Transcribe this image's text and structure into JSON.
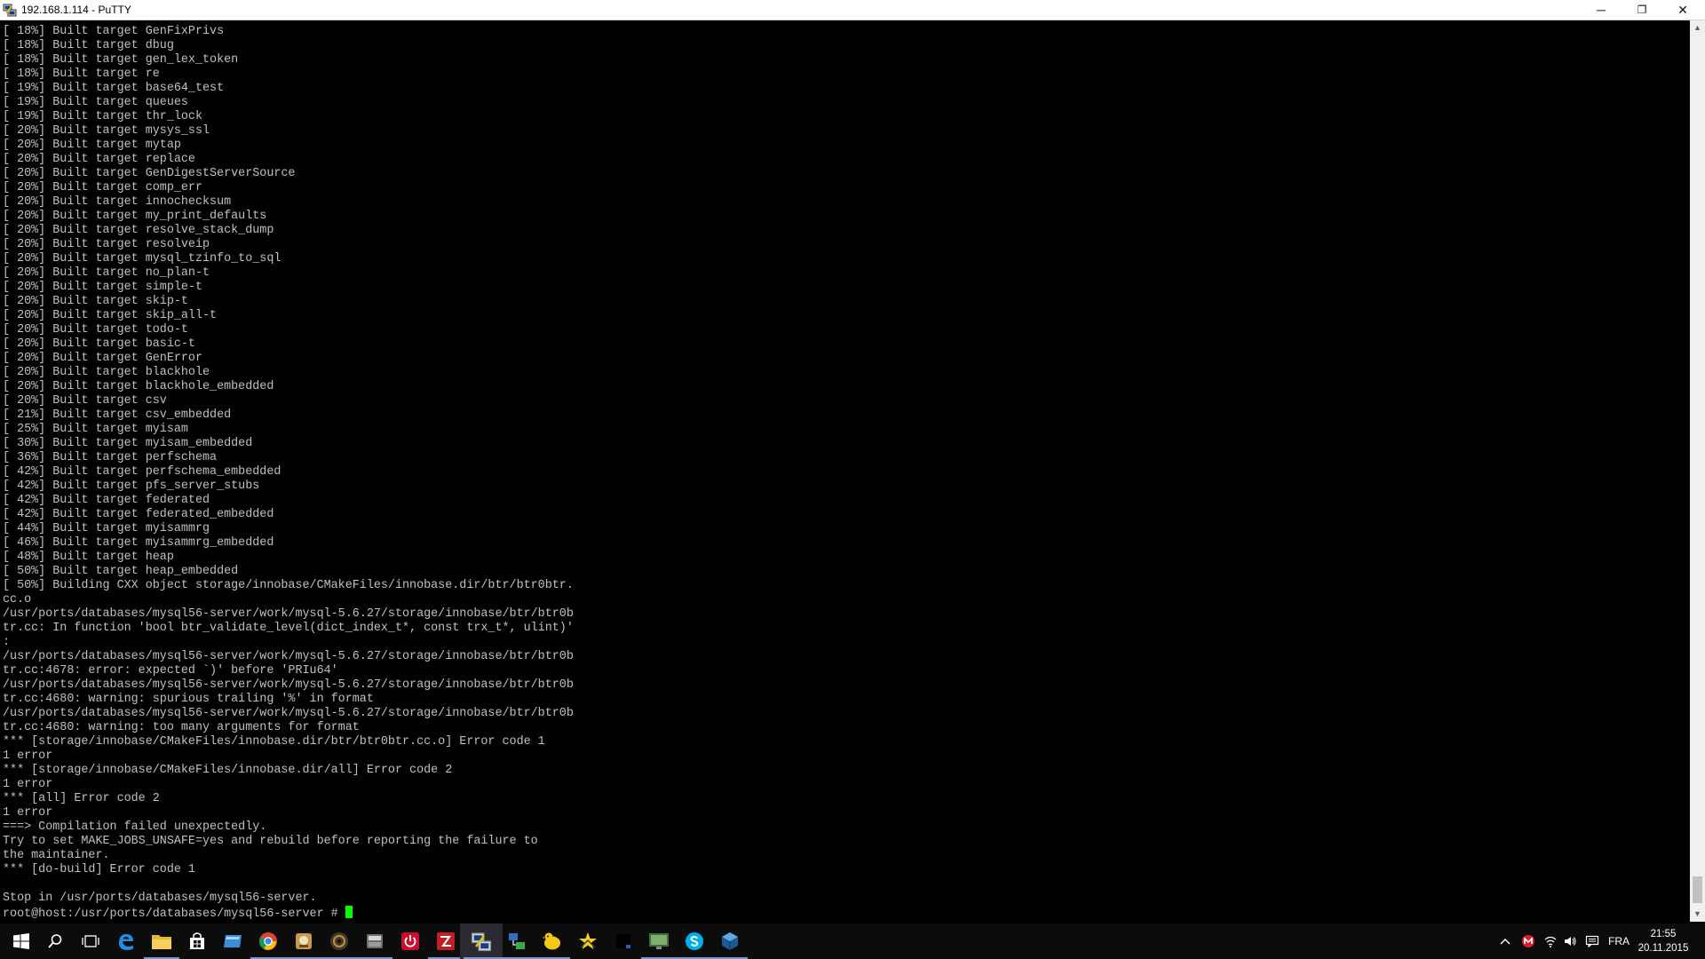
{
  "window": {
    "title": "192.168.1.114 - PuTTY",
    "app_icon": "putty-icon",
    "controls": {
      "minimize": "─",
      "maximize": "❐",
      "close": "✕"
    }
  },
  "terminal": {
    "lines": [
      "[ 18%] Built target GenFixPrivs",
      "[ 18%] Built target dbug",
      "[ 18%] Built target gen_lex_token",
      "[ 18%] Built target re",
      "[ 19%] Built target base64_test",
      "[ 19%] Built target queues",
      "[ 19%] Built target thr_lock",
      "[ 20%] Built target mysys_ssl",
      "[ 20%] Built target mytap",
      "[ 20%] Built target replace",
      "[ 20%] Built target GenDigestServerSource",
      "[ 20%] Built target comp_err",
      "[ 20%] Built target innochecksum",
      "[ 20%] Built target my_print_defaults",
      "[ 20%] Built target resolve_stack_dump",
      "[ 20%] Built target resolveip",
      "[ 20%] Built target mysql_tzinfo_to_sql",
      "[ 20%] Built target no_plan-t",
      "[ 20%] Built target simple-t",
      "[ 20%] Built target skip-t",
      "[ 20%] Built target skip_all-t",
      "[ 20%] Built target todo-t",
      "[ 20%] Built target basic-t",
      "[ 20%] Built target GenError",
      "[ 20%] Built target blackhole",
      "[ 20%] Built target blackhole_embedded",
      "[ 20%] Built target csv",
      "[ 21%] Built target csv_embedded",
      "[ 25%] Built target myisam",
      "[ 30%] Built target myisam_embedded",
      "[ 36%] Built target perfschema",
      "[ 42%] Built target perfschema_embedded",
      "[ 42%] Built target pfs_server_stubs",
      "[ 42%] Built target federated",
      "[ 42%] Built target federated_embedded",
      "[ 44%] Built target myisammrg",
      "[ 46%] Built target myisammrg_embedded",
      "[ 48%] Built target heap",
      "[ 50%] Built target heap_embedded",
      "[ 50%] Building CXX object storage/innobase/CMakeFiles/innobase.dir/btr/btr0btr.",
      "cc.o",
      "/usr/ports/databases/mysql56-server/work/mysql-5.6.27/storage/innobase/btr/btr0b",
      "tr.cc: In function 'bool btr_validate_level(dict_index_t*, const trx_t*, ulint)'",
      ":",
      "/usr/ports/databases/mysql56-server/work/mysql-5.6.27/storage/innobase/btr/btr0b",
      "tr.cc:4678: error: expected `)' before 'PRIu64'",
      "/usr/ports/databases/mysql56-server/work/mysql-5.6.27/storage/innobase/btr/btr0b",
      "tr.cc:4680: warning: spurious trailing '%' in format",
      "/usr/ports/databases/mysql56-server/work/mysql-5.6.27/storage/innobase/btr/btr0b",
      "tr.cc:4680: warning: too many arguments for format",
      "*** [storage/innobase/CMakeFiles/innobase.dir/btr/btr0btr.cc.o] Error code 1",
      "1 error",
      "*** [storage/innobase/CMakeFiles/innobase.dir/all] Error code 2",
      "1 error",
      "*** [all] Error code 2",
      "1 error",
      "===> Compilation failed unexpectedly.",
      "Try to set MAKE_JOBS_UNSAFE=yes and rebuild before reporting the failure to",
      "the maintainer.",
      "*** [do-build] Error code 1",
      "",
      "Stop in /usr/ports/databases/mysql56-server."
    ],
    "prompt": "root@host:/usr/ports/databases/mysql56-server # ",
    "text_color": "#c0c0c0",
    "cursor_color": "#00ff00"
  },
  "taskbar": {
    "items": [
      {
        "name": "start-button",
        "icon": "windows-logo-icon",
        "state": "idle"
      },
      {
        "name": "search-button",
        "icon": "search-icon",
        "state": "idle"
      },
      {
        "name": "task-view-button",
        "icon": "task-view-icon",
        "state": "idle"
      },
      {
        "name": "taskbar-edge",
        "icon": "edge-icon",
        "state": "idle"
      },
      {
        "name": "taskbar-file-explorer",
        "icon": "folder-icon",
        "state": "running"
      },
      {
        "name": "taskbar-store",
        "icon": "store-icon",
        "state": "idle"
      },
      {
        "name": "taskbar-app-blue",
        "icon": "blue-window-icon",
        "state": "idle"
      },
      {
        "name": "taskbar-chrome",
        "icon": "chrome-icon",
        "state": "running"
      },
      {
        "name": "taskbar-app-badge",
        "icon": "badge-app-icon",
        "state": "running"
      },
      {
        "name": "taskbar-app-disc",
        "icon": "disc-icon",
        "state": "running"
      },
      {
        "name": "taskbar-app-box",
        "icon": "box-app-icon",
        "state": "running"
      },
      {
        "name": "taskbar-app-power",
        "icon": "power-icon",
        "state": "idle"
      },
      {
        "name": "taskbar-app-filezilla",
        "icon": "filezilla-icon",
        "state": "running"
      },
      {
        "name": "taskbar-putty",
        "icon": "putty-icon",
        "state": "active"
      },
      {
        "name": "taskbar-app-network",
        "icon": "network-icon",
        "state": "running"
      },
      {
        "name": "taskbar-app-chick",
        "icon": "chick-icon",
        "state": "running"
      },
      {
        "name": "taskbar-app-star",
        "icon": "star-icon",
        "state": "idle"
      },
      {
        "name": "taskbar-app-black",
        "icon": "black-window-icon",
        "state": "idle"
      },
      {
        "name": "taskbar-app-monitor",
        "icon": "monitor-icon",
        "state": "running"
      },
      {
        "name": "taskbar-skype",
        "icon": "skype-icon",
        "state": "running"
      },
      {
        "name": "taskbar-virtualbox",
        "icon": "virtualbox-icon",
        "state": "running"
      }
    ],
    "tray": {
      "chevron": "^",
      "language": "FRA",
      "time": "21:55",
      "date": "20.11.2015"
    }
  }
}
